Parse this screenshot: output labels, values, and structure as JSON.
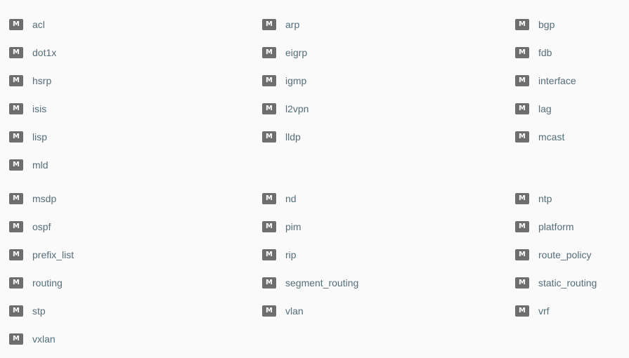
{
  "badge_letter": "M",
  "colors": {
    "background": "#fafafa",
    "badge": "#6e6e6e",
    "text": "#546e7a"
  },
  "groups": [
    {
      "modules": [
        "acl",
        "arp",
        "bgp",
        "dot1x",
        "eigrp",
        "fdb",
        "hsrp",
        "igmp",
        "interface",
        "isis",
        "l2vpn",
        "lag",
        "lisp",
        "lldp",
        "mcast",
        "mld"
      ]
    },
    {
      "modules": [
        "msdp",
        "nd",
        "ntp",
        "ospf",
        "pim",
        "platform",
        "prefix_list",
        "rip",
        "route_policy",
        "routing",
        "segment_routing",
        "static_routing",
        "stp",
        "vlan",
        "vrf",
        "vxlan"
      ]
    }
  ]
}
